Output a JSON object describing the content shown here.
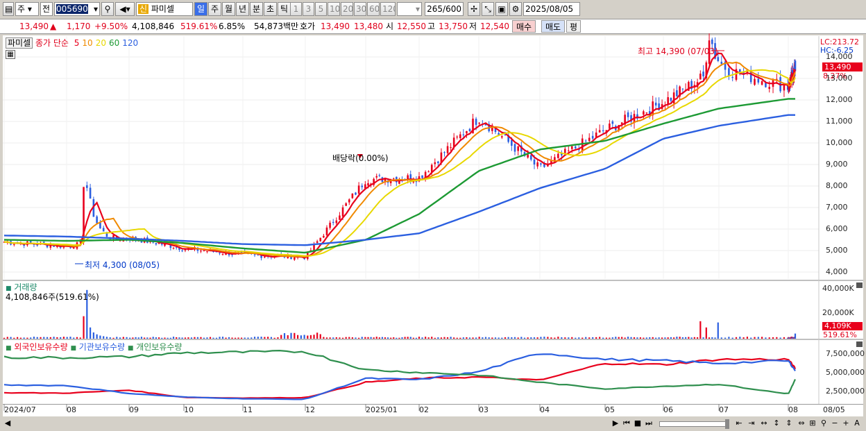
{
  "toolbar": {
    "market": "주",
    "prev": "전",
    "code": "005690",
    "name_badge": "신",
    "name": "파미셀",
    "periods": [
      "일",
      "주",
      "월",
      "년",
      "분",
      "초",
      "틱"
    ],
    "active_period": "일",
    "intervals": [
      "1",
      "3",
      "5",
      "10",
      "20",
      "30",
      "60",
      "120"
    ],
    "count": "265",
    "count_total": "/600",
    "date": "2025/08/05"
  },
  "info": {
    "price": "13,490",
    "arrow": "▲",
    "change": "1,170",
    "change_pct": "+9.50%",
    "volume": "4,108,846",
    "vol_ratio": "519.61%",
    "turnover": "6.85%",
    "amount": "54,873백만",
    "bid_label": "호가",
    "ask": "13,490",
    "bid": "13,480",
    "open_label": "시",
    "open": "12,550",
    "high_label": "고",
    "high": "13,750",
    "low_label": "저",
    "low": "12,540",
    "buy": "매수",
    "sell": "매도",
    "eval": "평"
  },
  "price_panel": {
    "title": "파미셀",
    "legend_prefix": "종가 단순",
    "ma_labels": [
      "5",
      "10",
      "20",
      "60",
      "120"
    ],
    "ma_colors": [
      "#e8001c",
      "#f08a00",
      "#e8d800",
      "#1d9a34",
      "#2b5fe0"
    ],
    "lc": "LC:213.72",
    "hc": "HC:-6.25",
    "last_price": "13,490",
    "last_pct": "8.27%",
    "hi_ann": "최고 14,390 (07/03)",
    "lo_ann": "최저 4,300 (08/05)",
    "div_ann": "배당락(0.00%)",
    "y_labels": [
      "14,000",
      "13,000",
      "12,000",
      "11,000",
      "10,000",
      "9,000",
      "8,000",
      "7,000",
      "6,000",
      "5,000",
      "4,000"
    ]
  },
  "volume_panel": {
    "title": "거래량",
    "value": "4,108,846주(519.61%)",
    "y_labels": [
      "40,000K",
      "20,000K"
    ],
    "last": "4,109K",
    "last_pct": "519.61%"
  },
  "holdings_panel": {
    "legend": [
      "외국인보유수량",
      "기관보유수량",
      "개인보유수량"
    ],
    "colors": [
      "#e8001c",
      "#2b5fe0",
      "#2f8f4e"
    ],
    "y_labels": [
      "7,500,000",
      "5,000,000",
      "2,500,000"
    ]
  },
  "x_axis": {
    "labels": [
      "2024/07",
      "08",
      "09",
      "10",
      "11",
      "12",
      "2025/01",
      "02",
      "03",
      "04",
      "05",
      "06",
      "07",
      "08",
      "08/05"
    ]
  },
  "chart_data": {
    "type": "line",
    "title": "파미셀",
    "x": [
      "2024/07",
      "2024/08",
      "2024/09",
      "2024/10",
      "2024/11",
      "2024/12",
      "2025/01",
      "2025/02",
      "2025/03",
      "2025/04",
      "2025/05",
      "2025/06",
      "2025/07",
      "2025/08"
    ],
    "series": [
      {
        "name": "종가",
        "values": [
          5400,
          5200,
          6000,
          5100,
          4800,
          5000,
          8300,
          8600,
          11700,
          8700,
          10700,
          11900,
          13200,
          13490
        ]
      },
      {
        "name": "5",
        "values": [
          5400,
          5250,
          6100,
          5150,
          4850,
          5100,
          8200,
          8500,
          11500,
          8800,
          10600,
          11800,
          13000,
          13200
        ]
      },
      {
        "name": "60",
        "values": [
          5500,
          5450,
          5500,
          5350,
          5100,
          4900,
          5500,
          6700,
          8700,
          9700,
          10100,
          10900,
          11600,
          12050
        ]
      },
      {
        "name": "120",
        "values": [
          5700,
          5650,
          5550,
          5450,
          5300,
          5250,
          5500,
          5800,
          6800,
          7900,
          8800,
          10200,
          10800,
          11300
        ]
      }
    ],
    "ylim": [
      4000,
      14500
    ]
  }
}
